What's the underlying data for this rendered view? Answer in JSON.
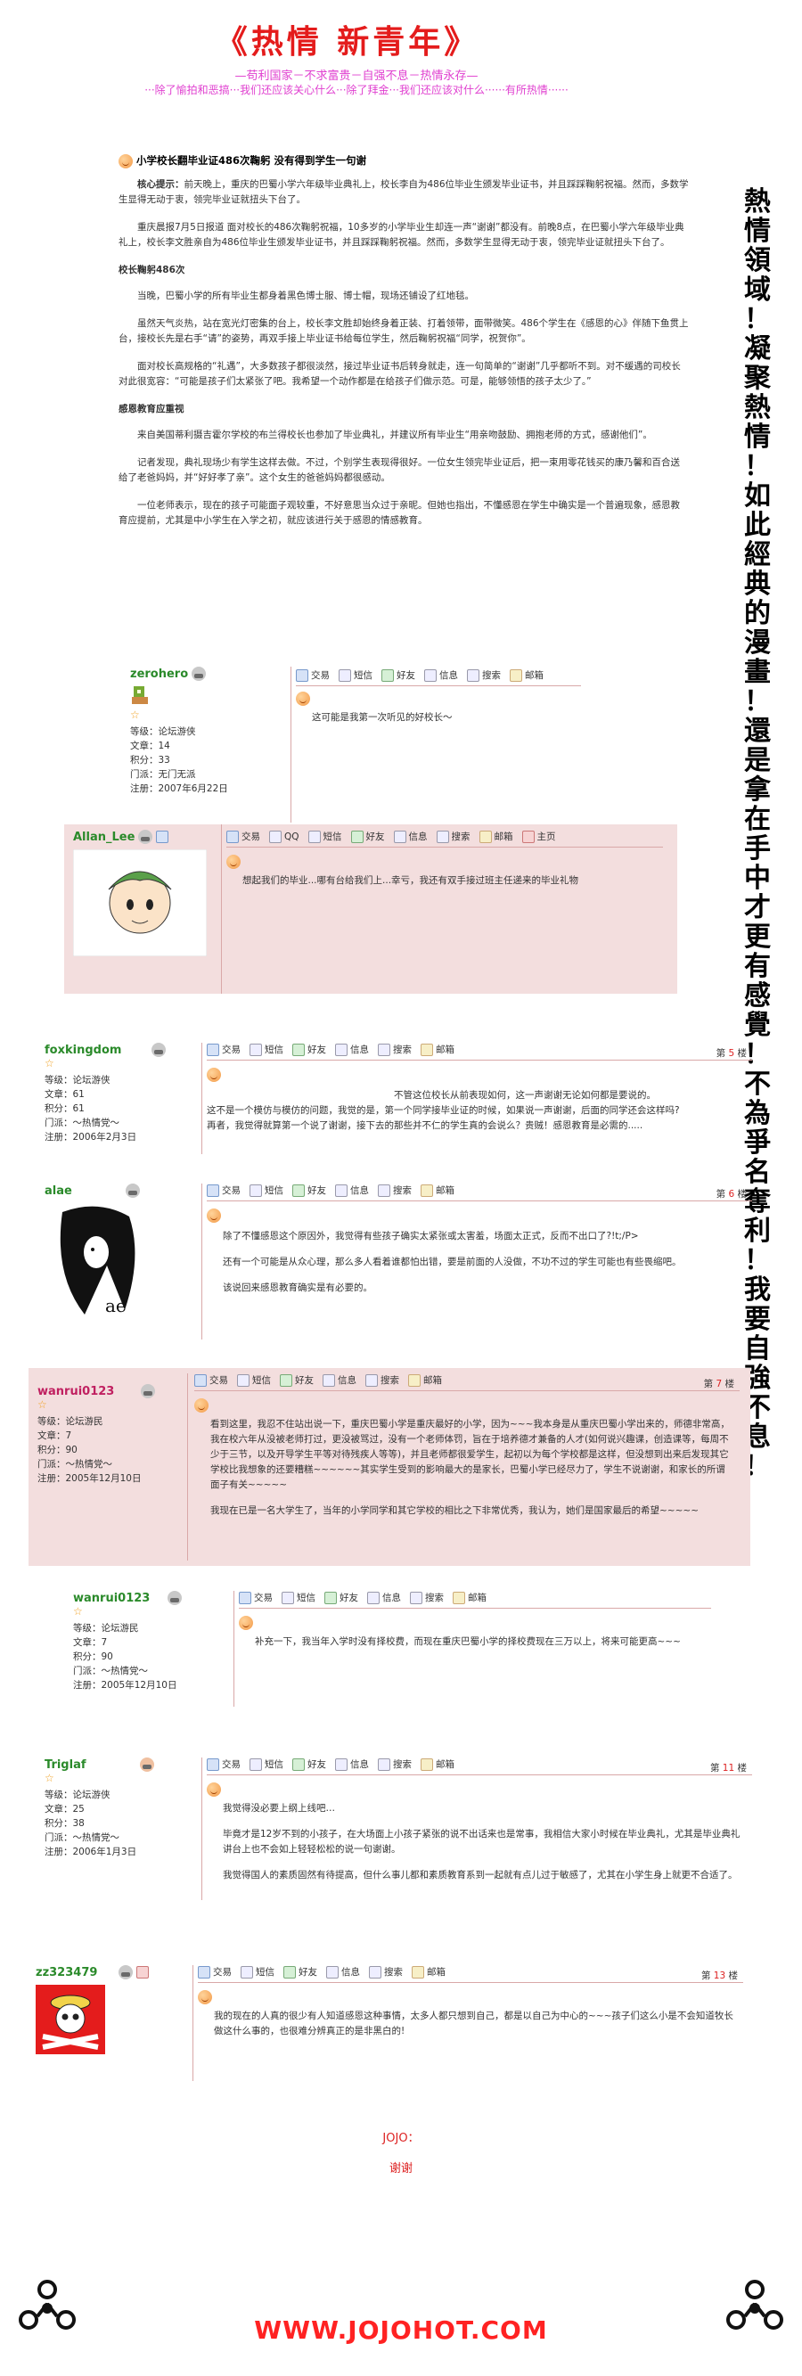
{
  "header": {
    "title": "《热情  新青年》",
    "slogan1": "—苟利国家－不求富贵－自强不息－热情永存—",
    "slogan2": "···除了愉拍和恶搞···我们还应该关心什么···除了拜金···我们还应该对什么······有所热情······"
  },
  "sidebar": {
    "motto": "熱情領域！凝聚熱情！如此經典的漫畫！還是拿在手中才更有感覺！不為爭名奪利！我要自強不息！"
  },
  "article": {
    "title": "小学校长翻毕业证486次鞠躬 没有得到学生一句谢",
    "p1_lead": "核心提示：",
    "p1": "前天晚上，重庆的巴蜀小学六年级毕业典礼上，校长李自为486位毕业生颁发毕业证书，并且踩踩鞠躬祝福。然而，多数学生显得无动于衷，领完毕业证就扭头下台了。",
    "p2": "重庆晨报7月5日报道 面对校长的486次鞠躬祝福，10多岁的小学毕业生却连一声“谢谢”都没有。前晚8点，在巴蜀小学六年级毕业典礼上，校长李文胜亲自为486位毕业生颁发毕业证书，并且踩踩鞠躬祝福。然而，多数学生显得无动于衷，领完毕业证就扭头下台了。",
    "sub1": "校长鞠躬486次",
    "p3": "当晚，巴蜀小学的所有毕业生都身着黑色博士服、博士帽，现场还铺设了红地毯。",
    "p4": "虽然天气炎热，站在宽光灯密集的台上，校长李文胜却始终身着正装、打着领带，面带微笑。486个学生在《感恩的心》伴随下鱼贯上台，接校长先是右手“请”的姿势，再双手接上毕业证书给每位学生，然后鞠躬祝福“同学，祝贺你”。",
    "p5": "面对校长高规格的“礼遇”，大多数孩子都很淡然，接过毕业证书后转身就走，连一句简单的“谢谢”几乎都听不到。对不缓遇的司校长对此很宽容：“可能是孩子们太紧张了吧。我希望一个动作都是在给孩子们做示范。可是，能够领悟的孩子太少了。”",
    "sub2": "感恩教育应重视",
    "p6": "来自美国蒂利摄吉霍尔学校的布兰得校长也参加了毕业典礼，并建议所有毕业生“用亲吻鼓励、拥抱老师的方式，感谢他们”。",
    "p7": "记者发现，典礼现场少有学生这样去做。不过，个别学生表现得很好。一位女生领完毕业证后，把一束用零花钱买的康乃馨和百合送给了老爸妈妈，并“好好孝了亲”。这个女生的爸爸妈妈都很感动。",
    "p8": "一位老师表示，现在的孩子可能面子观较重，不好意思当众过于亲昵。但她也指出，不懂感恩在学生中确实是一个普遍现象，感恩教育应提前，尤其是中小学生在入学之初，就应该进行关于感恩的情感教育。"
  },
  "toolbar": {
    "trade": "交易",
    "qq": "QQ",
    "msg": "短信",
    "friend": "好友",
    "info": "信息",
    "search": "搜索",
    "mail": "邮箱",
    "home": "主页",
    "floor_prefix": "第",
    "floor_suffix": "楼"
  },
  "labels": {
    "level": "等级：",
    "posts": "文章：",
    "points": "积分：",
    "faction": "门派：",
    "joined": "注册："
  },
  "posts": [
    {
      "user": "zerohero",
      "level": "论坛游侠",
      "posts": "14",
      "points": "33",
      "faction": "无门无派",
      "joined": "2007年6月22日",
      "floor": "",
      "text": [
        "这可能是我第一次听见的好校长～"
      ]
    },
    {
      "user": "Allan_Lee",
      "floor": "",
      "text": [
        "想起我们的毕业...哪有台给我们上...幸亏，我还有双手接过班主任递来的毕业礼物"
      ]
    },
    {
      "user": "foxkingdom",
      "level": "论坛游侠",
      "posts": "61",
      "points": "61",
      "faction": "～热情党～",
      "joined": "2006年2月3日",
      "floor": "5",
      "text": [
        "不管这位校长从前表现如何，这一声谢谢无论如何都是要说的。",
        "这不是一个模仿与模仿的问题，我觉的是，第一个同学接毕业证的时候，如果说一声谢谢，后面的同学还会这样吗?",
        "再者，我觉得就算第一个说了谢谢，接下去的那些并不仁的学生真的会说么？贵贼！感恩教育是必需的....."
      ]
    },
    {
      "user": "alae",
      "floor": "6",
      "text": [
        "除了不懂感恩这个原因外，我觉得有些孩子确实太紧张或太害羞，场面太正式，反而不出口了?!t;/P>",
        "还有一个可能是从众心理，那么多人看着谁都怕出错，要是前面的人没做，不功不过的学生可能也有些畏缩吧。",
        "该说回来感恩教育确实是有必要的。"
      ]
    },
    {
      "user": "wanrui0123",
      "level": "论坛游民",
      "posts": "7",
      "points": "90",
      "faction": "～热情党～",
      "joined": "2005年12月10日",
      "floor": "7",
      "text": [
        "看到这里，我忍不住站出说一下，重庆巴蜀小学是重庆最好的小学，因为~~~我本身是从重庆巴蜀小学出来的，师德非常高，我在校六年从没被老师打过，更没被骂过，没有一个老师体罚，旨在于培养德才兼备的人才(如何说兴趣课，创造课等，每周不少于三节，以及开导学生平等对待残疾人等等)，并且老师都很爱学生，起初以为每个学校都是这样，但没想到出来后发现其它学校比我想象的还要糟糕~~~~~~其实学生受到的影响最大的是家长，巴蜀小学已经尽力了，学生不说谢谢，和家长的所谓面子有关~~~~~",
        "我现在已是一名大学生了，当年的小学同学和其它学校的相比之下非常优秀，我认为，她们是国家最后的希望~~~~~"
      ]
    },
    {
      "user": "wanrui0123",
      "level": "论坛游民",
      "posts": "7",
      "points": "90",
      "faction": "～热情党～",
      "joined": "2005年12月10日",
      "floor": "",
      "text": [
        "补充一下，我当年入学时没有择校费，而现在重庆巴蜀小学的择校费现在三万以上，将来可能更高~~~"
      ]
    },
    {
      "user": "Triglaf",
      "level": "论坛游侠",
      "posts": "25",
      "points": "38",
      "faction": "～热情党～",
      "joined": "2006年1月3日",
      "floor": "11",
      "text": [
        "我觉得没必要上纲上线吧…",
        "毕竟才是12岁不到的小孩子，在大场面上小孩子紧张的说不出话来也是常事，我相信大家小时候在毕业典礼，尤其是毕业典礼讲台上也不会如上轻轻松松的说一句谢谢。",
        "我觉得国人的素质固然有待提高，但什么事儿都和素质教育系到一起就有点儿过于敏感了，尤其在小学生身上就更不合适了。"
      ]
    },
    {
      "user": "zz323479",
      "floor": "13",
      "text": [
        "我的现在的人真的很少有人知道感恩这种事情，太多人都只想到自己，都是以自己为中心的~~~孩子们这么小是不会知道牧长做这什么事的，也很难分辨真正的是非黑白的!"
      ]
    }
  ],
  "signature": {
    "line1": "JOJO：",
    "line2": "谢谢"
  },
  "footer": {
    "url": "WWW.JOJOHOT.COM"
  },
  "colors": {
    "title_red": "#e41c1c",
    "slogan_pink": "#e040d0",
    "post_bg_pink": "#f3dede",
    "username_green": "#2a8a2a"
  }
}
